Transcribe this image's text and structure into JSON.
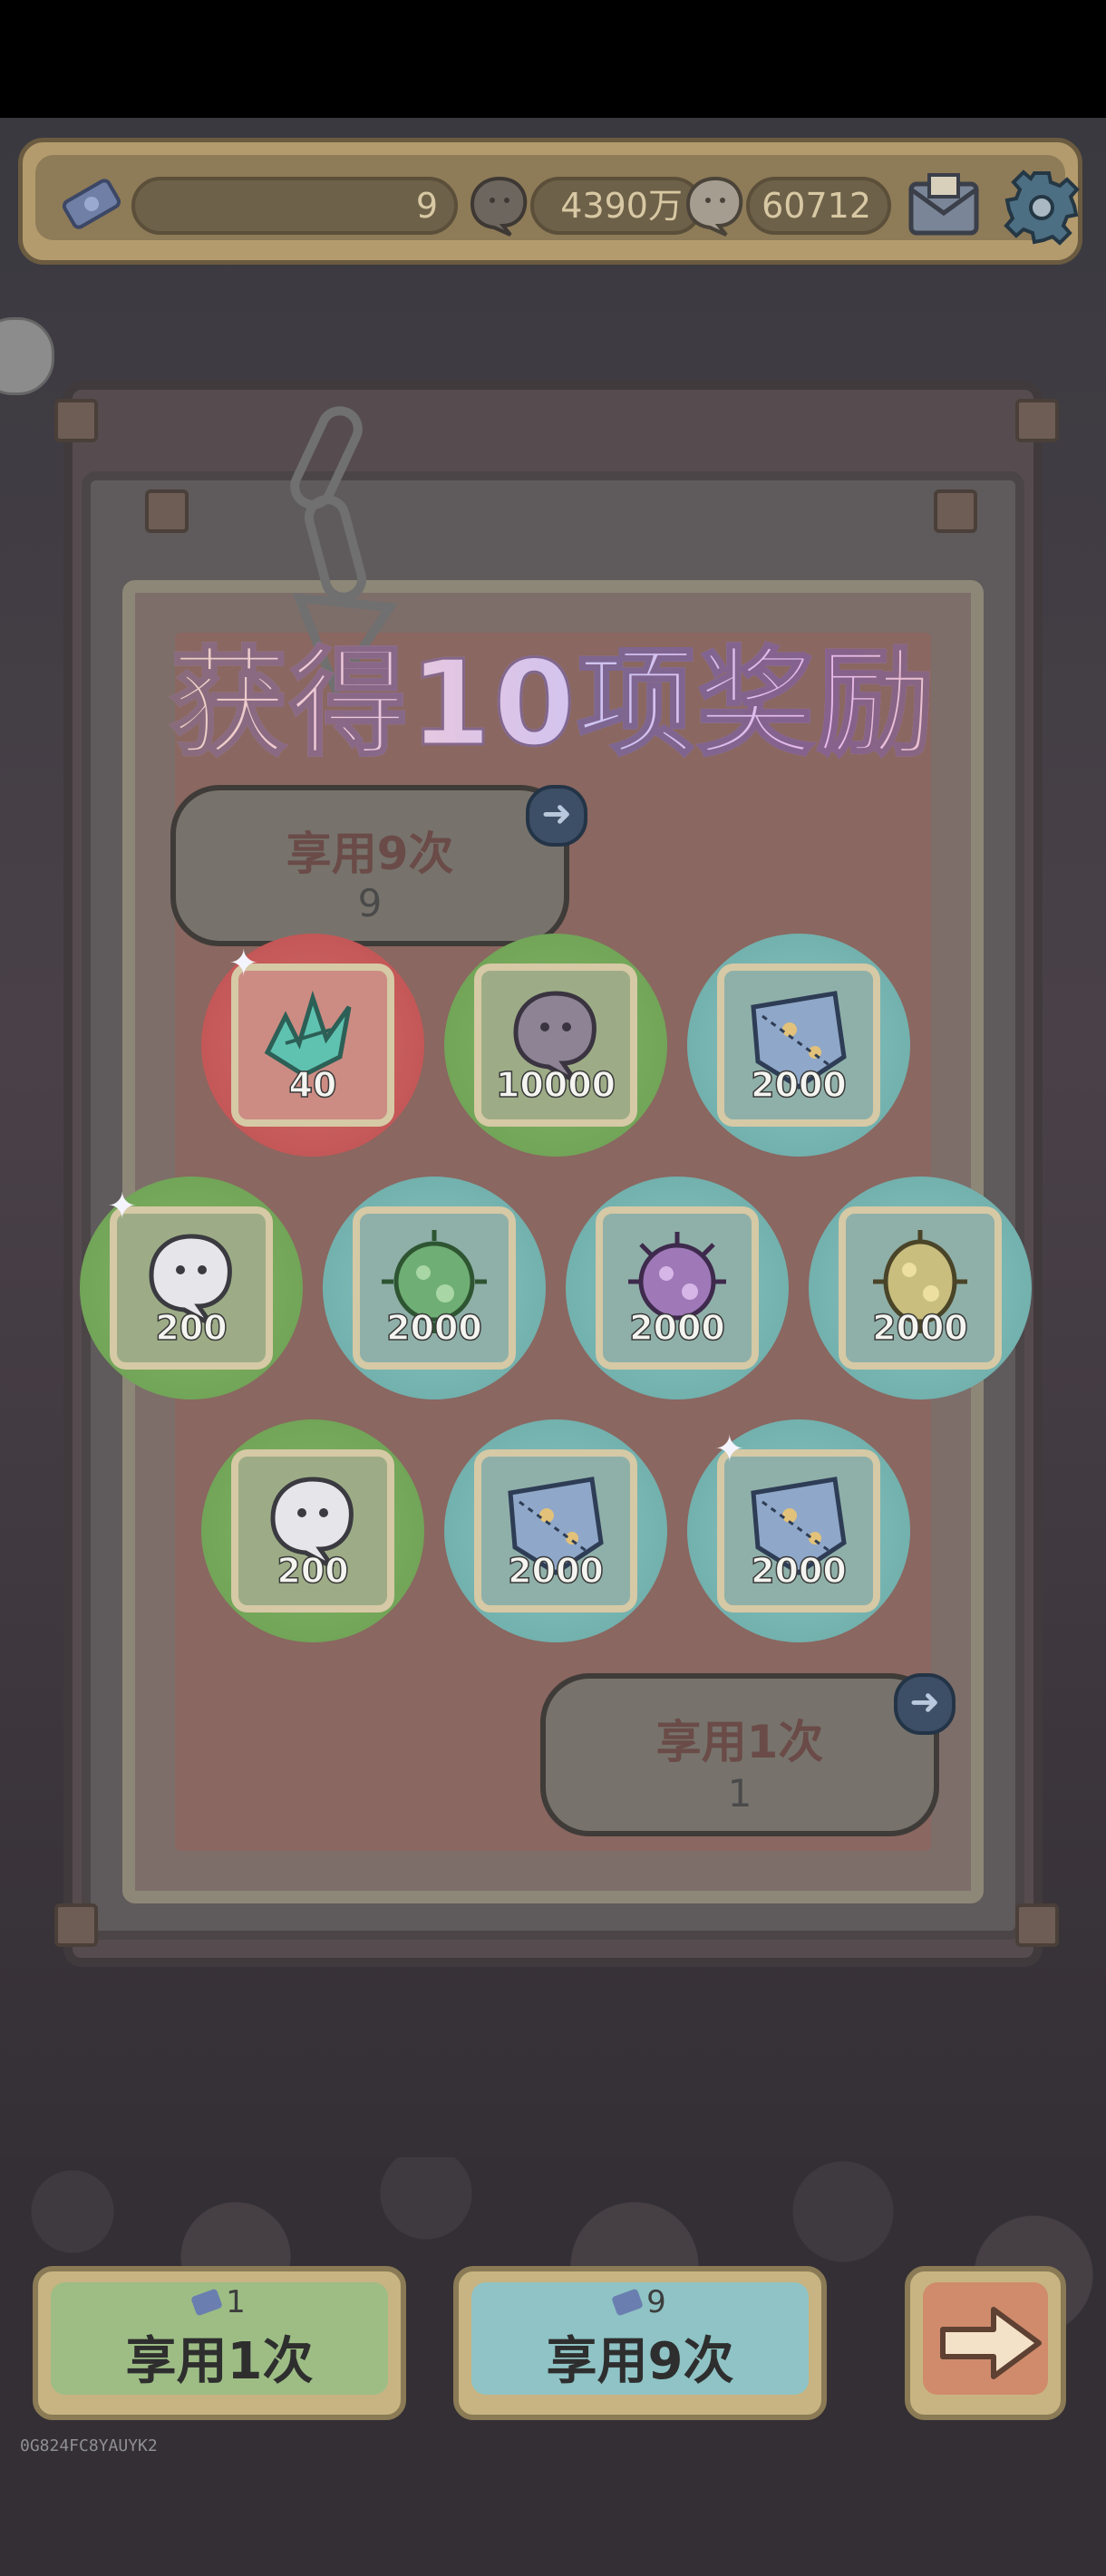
{
  "topbar": {
    "tickets": "9",
    "currency1": "4390万",
    "currency2": "60712"
  },
  "title": "获得10项奖励",
  "use9": {
    "label": "享用9次",
    "count": "9"
  },
  "use1": {
    "label": "享用1次",
    "count": "1"
  },
  "rewards": [
    {
      "amount": "40",
      "color": "red",
      "item": "crystal-wings"
    },
    {
      "amount": "10000",
      "color": "green",
      "item": "purple-bubble"
    },
    {
      "amount": "2000",
      "color": "teal",
      "item": "blue-fabric"
    },
    {
      "amount": "200",
      "color": "green",
      "item": "white-bubble"
    },
    {
      "amount": "2000",
      "color": "teal",
      "item": "green-virus"
    },
    {
      "amount": "2000",
      "color": "teal",
      "item": "purple-virus"
    },
    {
      "amount": "2000",
      "color": "teal",
      "item": "yellow-virus"
    },
    {
      "amount": "200",
      "color": "green",
      "item": "white-bubble"
    },
    {
      "amount": "2000",
      "color": "teal",
      "item": "blue-fabric"
    },
    {
      "amount": "2000",
      "color": "teal",
      "item": "blue-fabric"
    }
  ],
  "buttons": {
    "use1": {
      "count": "1",
      "label": "享用1次"
    },
    "use9": {
      "count": "9",
      "label": "享用9次"
    }
  },
  "footer_id": "0G824FC8YAUYK2"
}
